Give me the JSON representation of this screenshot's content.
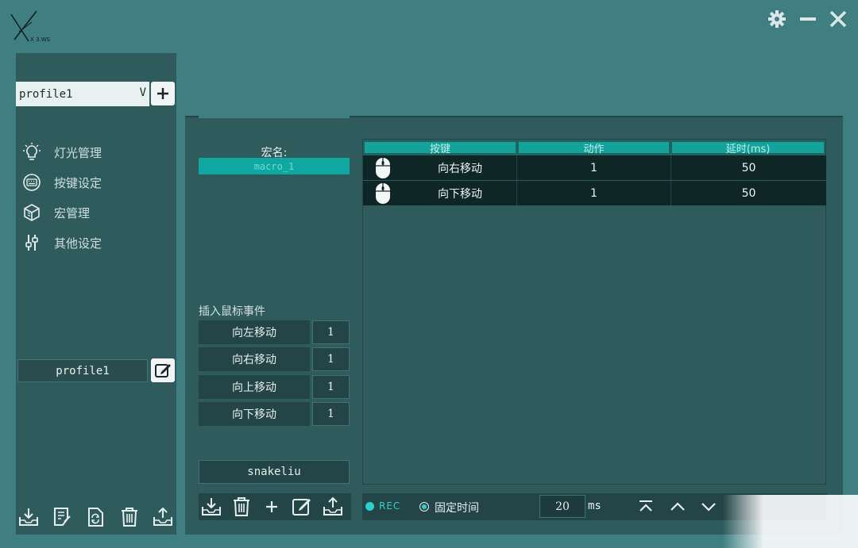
{
  "window": {
    "logo_text": "X 3.WS",
    "controls": [
      "settings",
      "minimize",
      "close"
    ]
  },
  "sidebar": {
    "profile_select": {
      "value": "profile1",
      "arrow": "V"
    },
    "nav_items": [
      {
        "label": "灯光管理",
        "icon": "lightbulb-icon"
      },
      {
        "label": "按键设定",
        "icon": "keyboard-icon"
      },
      {
        "label": "宏管理",
        "icon": "cube-icon"
      },
      {
        "label": "其他设定",
        "icon": "sliders-icon"
      }
    ],
    "profile_name": "profile1",
    "bottom_tools": [
      "import-icon",
      "notes-icon",
      "refresh-icon",
      "trash-icon",
      "export-icon"
    ]
  },
  "macro": {
    "name_label": "宏名:",
    "name_value": "macro_1",
    "insert_mouse_label": "插入鼠标事件",
    "mouse_events": [
      {
        "label": "向左移动",
        "value": "1"
      },
      {
        "label": "向右移动",
        "value": "1"
      },
      {
        "label": "向上移动",
        "value": "1"
      },
      {
        "label": "向下移动",
        "value": "1"
      }
    ],
    "user": "snakeliu",
    "toolbar": [
      "import-icon",
      "trash-icon",
      "plus-icon",
      "edit-icon",
      "export-icon"
    ]
  },
  "table": {
    "headers": [
      "按键",
      "动作",
      "延时(ms)"
    ],
    "rows": [
      {
        "key": "向右移动",
        "action": "1",
        "delay": "50"
      },
      {
        "key": "向下移动",
        "action": "1",
        "delay": "50"
      }
    ]
  },
  "bottom_bar": {
    "rec_label": "REC",
    "fixed_time_label": "固定时间",
    "delay_value": "20",
    "delay_unit": "ms"
  },
  "colors": {
    "background": "#3f7f82",
    "panel": "#2f5b5d",
    "accent": "#13a39a",
    "rec": "#27d2cf"
  }
}
